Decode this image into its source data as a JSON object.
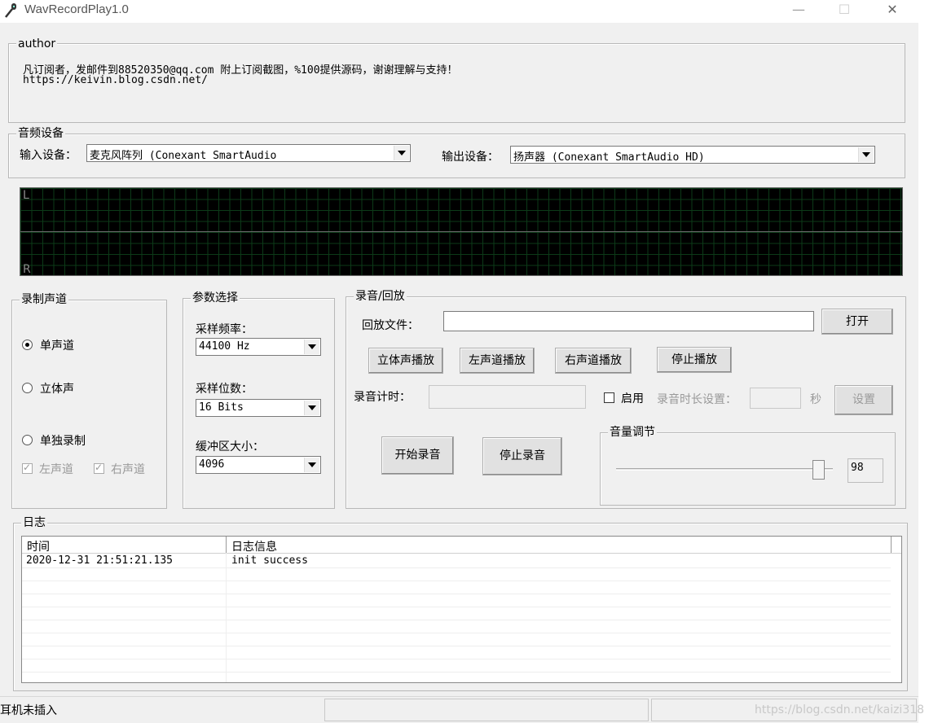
{
  "window": {
    "title": "WavRecordPlay1.0",
    "min": "—",
    "max": "☐",
    "close": "✕"
  },
  "author": {
    "legend": "author",
    "line1": "凡订阅者，发邮件到88520350@qq.com  附上订阅截图，%100提供源码，谢谢理解与支持！",
    "line2": "https://keivin.blog.csdn.net/"
  },
  "audio_device": {
    "legend": "音频设备",
    "input_label": "输入设备：",
    "input_value": "麦克风阵列 (Conexant SmartAudio",
    "output_label": "输出设备：",
    "output_value": "扬声器 (Conexant SmartAudio HD)"
  },
  "scope": {
    "left": "L",
    "right": "R"
  },
  "channel": {
    "legend": "录制声道",
    "mono": "单声道",
    "stereo": "立体声",
    "single": "单独录制",
    "left": "左声道",
    "right": "右声道"
  },
  "params": {
    "legend": "参数选择",
    "rate_label": "采样频率：",
    "rate_value": "44100 Hz",
    "bits_label": "采样位数：",
    "bits_value": "16 Bits",
    "buffer_label": "缓冲区大小：",
    "buffer_value": "4096"
  },
  "record": {
    "legend": "录音/回放",
    "file_label": "回放文件：",
    "file_value": "",
    "open": "打开",
    "play_stereo": "立体声播放",
    "play_left": "左声道播放",
    "play_right": "右声道播放",
    "stop_play": "停止播放",
    "timer_label": "录音计时：",
    "timer_value": "",
    "enable": "启用",
    "duration_label": "录音时长设置：",
    "duration_unit": "秒",
    "set": "设置",
    "start_rec": "开始录音",
    "stop_rec": "停止录音"
  },
  "volume": {
    "legend": "音量调节",
    "value": "98",
    "level": 0.98
  },
  "log": {
    "legend": "日志",
    "col_time": "时间",
    "col_msg": "日志信息",
    "rows": [
      {
        "time": "2020-12-31 21:51:21.135",
        "msg": "init success"
      }
    ]
  },
  "status": {
    "text": "耳机未插入",
    "watermark": "https://blog.csdn.net/kaizi318"
  }
}
